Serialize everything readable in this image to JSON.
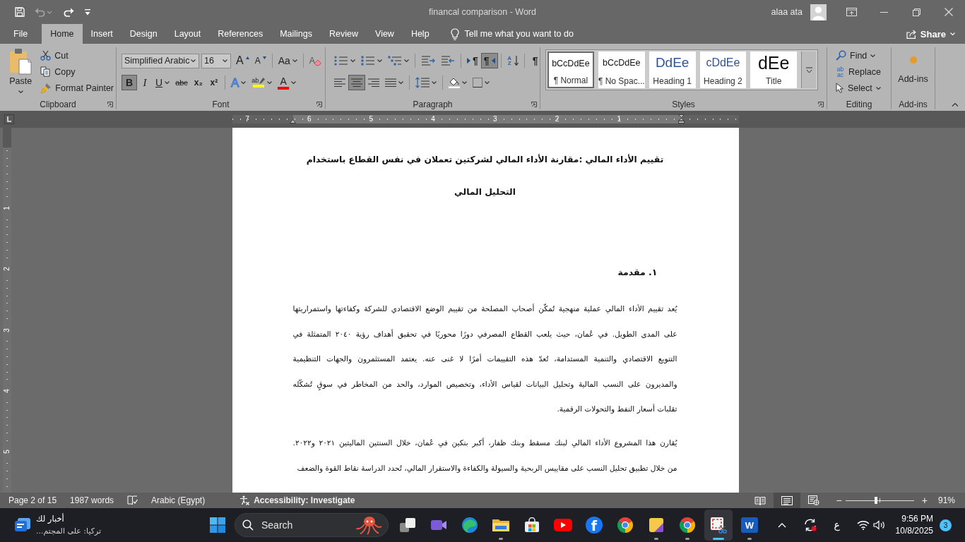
{
  "window": {
    "title": "financal comparison - Word",
    "user": "alaa ata"
  },
  "quick_access": [
    {
      "kind": "save",
      "disabled": false
    },
    {
      "kind": "undo",
      "disabled": true
    },
    {
      "kind": "redo",
      "disabled": false
    },
    {
      "kind": "customize",
      "disabled": false
    }
  ],
  "tabs": [
    {
      "label": "File",
      "selected": false
    },
    {
      "label": "Home",
      "selected": true
    },
    {
      "label": "Insert",
      "selected": false
    },
    {
      "label": "Design",
      "selected": false
    },
    {
      "label": "Layout",
      "selected": false
    },
    {
      "label": "References",
      "selected": false
    },
    {
      "label": "Mailings",
      "selected": false
    },
    {
      "label": "Review",
      "selected": false
    },
    {
      "label": "View",
      "selected": false
    },
    {
      "label": "Help",
      "selected": false
    }
  ],
  "tell_me": {
    "label": "Tell me what you want to do"
  },
  "share": {
    "label": "Share"
  },
  "ribbon": {
    "clipboard": {
      "label": "Clipboard",
      "launcher": true,
      "paste": "Paste",
      "items": [
        {
          "kind": "cut",
          "label": "Cut"
        },
        {
          "kind": "copy",
          "label": "Copy"
        },
        {
          "kind": "painter",
          "label": "Format Painter"
        }
      ]
    },
    "font": {
      "label": "Font",
      "launcher": true,
      "font_name": "Simplified Arabic",
      "font_size": "16",
      "row1": [
        [
          {
            "kind": "grow",
            "glyph": "A",
            "menu": false
          },
          {
            "kind": "shrink",
            "glyph": "A",
            "menu": false
          }
        ],
        [
          {
            "kind": "case",
            "glyph": "Aa",
            "menu": true
          }
        ],
        [
          {
            "kind": "clear",
            "glyph": "A",
            "menu": false
          }
        ]
      ],
      "row2": [
        [
          {
            "kind": "bold",
            "glyph": "B",
            "menu": false,
            "pressed": true
          },
          {
            "kind": "italic",
            "glyph": "I",
            "menu": false,
            "pressed": false
          },
          {
            "kind": "underline",
            "glyph": "U",
            "menu": true,
            "pressed": false
          },
          {
            "kind": "strike",
            "glyph": "abc",
            "menu": false,
            "pressed": false
          },
          {
            "kind": "sub",
            "glyph": "x₂",
            "menu": false,
            "pressed": false
          },
          {
            "kind": "sup",
            "glyph": "x²",
            "menu": false,
            "pressed": false
          }
        ],
        [
          {
            "kind": "effects",
            "glyph": "A",
            "menu": true,
            "pressed": false
          },
          {
            "kind": "highlight",
            "glyph": "ab",
            "menu": true,
            "pressed": false,
            "color": "#ffff00"
          },
          {
            "kind": "color",
            "glyph": "A",
            "menu": true,
            "pressed": false,
            "color": "#ff0000"
          }
        ]
      ]
    },
    "paragraph": {
      "label": "Paragraph",
      "launcher": true,
      "row1": [
        [
          {
            "kind": "bullets",
            "menu": true,
            "pressed": false
          },
          {
            "kind": "numbering",
            "menu": true,
            "pressed": false
          },
          {
            "kind": "multilevel",
            "menu": true,
            "pressed": false
          }
        ],
        [
          {
            "kind": "decrease_indent",
            "menu": false,
            "pressed": false
          },
          {
            "kind": "increase_indent",
            "menu": false,
            "pressed": false
          }
        ],
        [
          {
            "kind": "ltr",
            "glyph": "¶",
            "menu": false,
            "pressed": false
          },
          {
            "kind": "rtl",
            "glyph": "¶",
            "menu": false,
            "pressed": true
          }
        ],
        [
          {
            "kind": "sort",
            "glyph": "AZ",
            "menu": false,
            "pressed": false
          }
        ],
        [
          {
            "kind": "show_marks",
            "glyph": "¶",
            "menu": false,
            "pressed": false
          }
        ]
      ],
      "row2": [
        [
          {
            "kind": "align_left",
            "menu": false,
            "pressed": false
          },
          {
            "kind": "align_center",
            "menu": false,
            "pressed": true
          },
          {
            "kind": "align_right",
            "menu": false,
            "pressed": false
          },
          {
            "kind": "justify",
            "menu": true,
            "pressed": false
          }
        ],
        [
          {
            "kind": "line_spacing",
            "menu": true,
            "pressed": false
          }
        ],
        [
          {
            "kind": "shading",
            "menu": true,
            "pressed": false
          },
          {
            "kind": "borders",
            "menu": true,
            "pressed": false
          }
        ]
      ]
    },
    "styles": {
      "label": "Styles",
      "launcher": true,
      "items": [
        {
          "kind": "normal",
          "sample": "bCcDdEe",
          "name": "¶ Normal",
          "selected": true
        },
        {
          "kind": "no_spacing",
          "sample": "bCcDdEe",
          "name": "¶ No Spac...",
          "selected": false
        },
        {
          "kind": "heading1",
          "sample": "DdEe",
          "name": "Heading 1",
          "selected": false
        },
        {
          "kind": "heading2",
          "sample": "cDdEe",
          "name": "Heading 2",
          "selected": false
        },
        {
          "kind": "title",
          "sample": "dEe",
          "name": "Title",
          "selected": false
        }
      ]
    },
    "editing": {
      "label": "Editing",
      "launcher": false,
      "items": [
        {
          "kind": "find",
          "label": "Find",
          "menu": true
        },
        {
          "kind": "replace",
          "glyph": "ab ac",
          "label": "Replace",
          "menu": false
        },
        {
          "kind": "select",
          "label": "Select",
          "menu": true
        }
      ]
    },
    "addins": {
      "label": "Add-ins",
      "launcher": false,
      "button": "Add-ins"
    }
  },
  "rulers": {
    "horizontal": [
      "7",
      "6",
      "5",
      "4",
      "3",
      "2",
      "1"
    ],
    "vertical": [
      "1",
      "2",
      "3",
      "4",
      "5"
    ]
  },
  "document": {
    "title_lines": [
      "تقييم الأداء المالي :مقارنة الأداء المالي لشركتين تعملان في نفس القطاع باستخدام",
      "التحليل المالي"
    ],
    "heading": "١. مقدمة",
    "paragraphs": [
      {
        "lines": [
          "يُعد تقييم الأداء المالي عملية منهجية تُمكّن أصحاب المصلحة من تقييم الوضع الاقتصادي للشركة وكفاءتها واستمراريتها",
          "على المدى الطويل. في عُمان، حيث يلعب القطاع المصرفي دورًا محوريًا في تحقيق أهداف رؤية ٢٠٤٠ المتمثلة في",
          "التنويع الاقتصادي والتنمية المستدامة، تُعدّ هذه التقييمات أمرًا لا غنى عنه. يعتمد المستثمرون والجهات التنظيمية",
          "والمديرون على النسب المالية وتحليل البيانات لقياس الأداء، وتخصيص الموارد، والحد من المخاطر في سوقٍ تُشكّله",
          "تقلبات أسعار النفط والتحولات الرقمية."
        ]
      },
      {
        "lines": [
          "يُقارن هذا المشروع الأداء المالي لبنك مسقط وبنك ظفار، أكبر بنكين في عُمان، خلال السنتين الماليتين ٢٠٢١ و٢٠٢٢.",
          "من خلال تطبيق تحليل النسب على مقاييس الربحية والسيولة والكفاءة والاستقرار المالي، تُحدد الدراسة نقاط القوة والضعف"
        ]
      }
    ]
  },
  "status_bar": {
    "page": "Page 2 of 15",
    "words": "1987 words",
    "language": "Arabic (Egypt)",
    "accessibility": "Accessibility: Investigate",
    "views": [
      {
        "kind": "read",
        "selected": false
      },
      {
        "kind": "print",
        "selected": true
      },
      {
        "kind": "web",
        "selected": false
      }
    ],
    "zoom": {
      "minus": "−",
      "plus": "+",
      "level": 0.45,
      "reading": "91%"
    }
  },
  "taskbar": {
    "news": {
      "title": "أخبار لك",
      "subtitle": "تركيا: على المجتم..."
    },
    "search": {
      "placeholder": "Search"
    },
    "apps": [
      {
        "kind": "task_view",
        "running": false,
        "selected": false
      },
      {
        "kind": "meet",
        "running": false,
        "selected": false
      },
      {
        "kind": "edge",
        "running": false,
        "selected": false
      },
      {
        "kind": "explorer",
        "running": true,
        "selected": false
      },
      {
        "kind": "store",
        "running": false,
        "selected": false
      },
      {
        "kind": "youtube",
        "running": false,
        "selected": false
      },
      {
        "kind": "facebook",
        "glyph": "f",
        "running": false,
        "selected": false
      },
      {
        "kind": "chrome",
        "running": false,
        "selected": false
      },
      {
        "kind": "notes",
        "running": true,
        "selected": false
      },
      {
        "kind": "chrome_profile",
        "running": true,
        "selected": false
      },
      {
        "kind": "snipping",
        "running": true,
        "selected": true
      },
      {
        "kind": "word",
        "glyph": "W",
        "running": true,
        "selected": false
      }
    ],
    "tray": {
      "input_language": "ع",
      "time": "9:56 PM",
      "date": "10/8/2025",
      "notifications": "3"
    }
  }
}
